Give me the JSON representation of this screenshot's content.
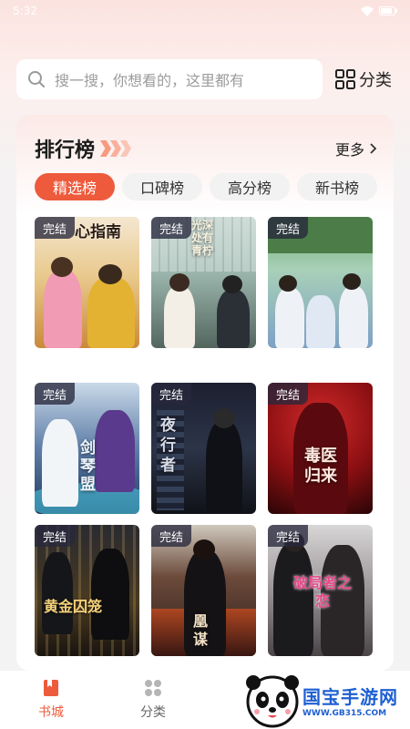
{
  "status_bar": {
    "time": "5:32",
    "battery_icon": "battery-icon",
    "wifi_icon": "wifi-icon"
  },
  "search": {
    "placeholder": "搜一搜，你想看的，这里都有",
    "icon": "search-icon"
  },
  "category_button": {
    "label": "分类",
    "icon": "grid-icon"
  },
  "ranking": {
    "title": "排行榜",
    "more_label": "更多",
    "tabs": [
      "精选榜",
      "口碑榜",
      "高分榜",
      "新书榜"
    ],
    "active_tab": 0,
    "books": [
      {
        "badge": "完结",
        "cover_text": "心指南"
      },
      {
        "badge": "完结",
        "cover_text": "光深处有青柠"
      },
      {
        "badge": "完结",
        "cover_text": ""
      },
      {
        "badge": "完结",
        "cover_text": "剑琴盟"
      },
      {
        "badge": "完结",
        "cover_text": "夜行者"
      },
      {
        "badge": "完结",
        "cover_text": "毒医归来"
      },
      {
        "badge": "完结",
        "cover_text": "黄金囚笼"
      },
      {
        "badge": "完结",
        "cover_text": "凰谋"
      },
      {
        "badge": "完结",
        "cover_text": "破局者之恋"
      }
    ]
  },
  "tabbar": {
    "items": [
      {
        "label": "书城",
        "icon": "book-icon",
        "active": true
      },
      {
        "label": "分类",
        "icon": "category-icon",
        "active": false
      }
    ]
  },
  "watermark": {
    "title": "国宝手游网",
    "url": "WWW.GB315.COM"
  },
  "colors": {
    "accent": "#ee5a3c",
    "watermark_blue": "#1e5fd2"
  }
}
